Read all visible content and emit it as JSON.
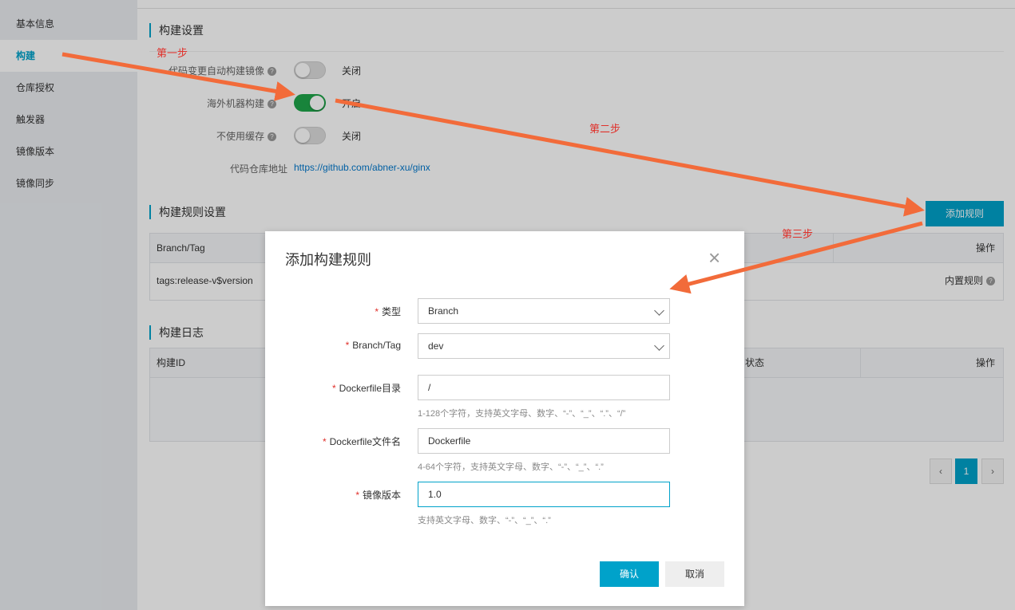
{
  "sidebar": {
    "items": [
      {
        "label": "基本信息",
        "active": false
      },
      {
        "label": "构建",
        "active": true
      },
      {
        "label": "仓库授权",
        "active": false
      },
      {
        "label": "触发器",
        "active": false
      },
      {
        "label": "镜像版本",
        "active": false
      },
      {
        "label": "镜像同步",
        "active": false
      }
    ]
  },
  "build_settings": {
    "title": "构建设置",
    "auto_build_label": "代码变更自动构建镜像",
    "auto_build_state": "关闭",
    "overseas_label": "海外机器构建",
    "overseas_state": "开启",
    "no_cache_label": "不使用缓存",
    "no_cache_state": "关闭",
    "repo_label": "代码仓库地址",
    "repo_url": "https://github.com/abner-xu/ginx",
    "help": "?"
  },
  "rules": {
    "title": "构建规则设置",
    "add_button": "添加规则",
    "col_branch": "Branch/Tag",
    "col_action": "操作",
    "row_value": "tags:release-v$version",
    "row_action": "内置规则"
  },
  "logs": {
    "title": "构建日志",
    "col_id": "构建ID",
    "col_status": "状态",
    "col_action": "操作"
  },
  "pager": {
    "prev": "‹",
    "page": "1",
    "next": "›"
  },
  "modal": {
    "title": "添加构建规则",
    "close": "×",
    "type_label": "类型",
    "type_value": "Branch",
    "branch_label": "Branch/Tag",
    "branch_value": "dev",
    "dockerfile_dir_label": "Dockerfile目录",
    "dockerfile_dir_value": "/",
    "dockerfile_dir_hint": "1-128个字符，支持英文字母、数字、“-”、“_”、“.”、“/”",
    "dockerfile_name_label": "Dockerfile文件名",
    "dockerfile_name_value": "Dockerfile",
    "dockerfile_name_hint": "4-64个字符，支持英文字母、数字、“-”、“_”、“.”",
    "version_label": "镜像版本",
    "version_value": "1.0",
    "version_hint": "支持英文字母、数字、“-”、“_”、“.”",
    "confirm": "确认",
    "cancel": "取消",
    "required_mark": "*"
  },
  "annotations": {
    "step1": "第一步",
    "step2": "第二步",
    "step3": "第三步"
  },
  "colors": {
    "accent": "#00a2ca",
    "toggle_on": "#1fa64a",
    "arrow": "#f26b3a",
    "annotation": "#e0312b"
  }
}
